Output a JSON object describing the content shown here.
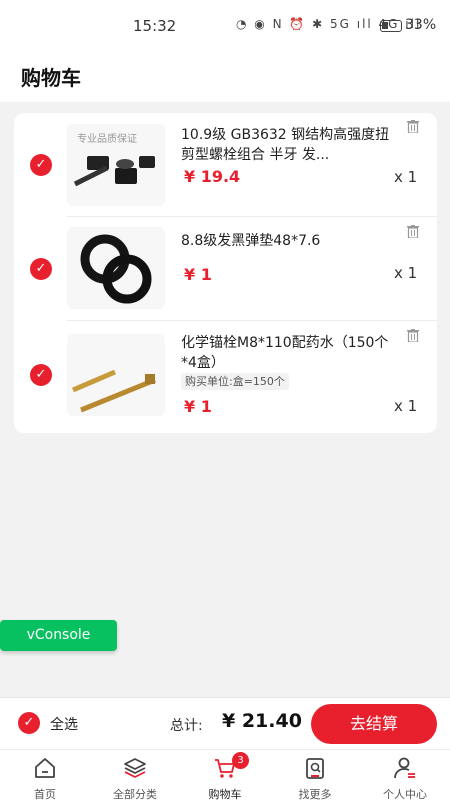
{
  "status_bar": {
    "time": "15:32",
    "battery": "33%",
    "indicators": "◔ ◉ N ⏰ ✱ 5G ıll 4G ıll"
  },
  "header": {
    "title": "购物车"
  },
  "cart_items": [
    {
      "name": "10.9级 GB3632 钢结构高强度扭剪型螺栓组合 半牙 发...",
      "price": "¥ 19.4",
      "qty": "x 1",
      "checked": true,
      "thumb_text": "专业品质保证"
    },
    {
      "name": "8.8级发黑弹垫48*7.6",
      "price": "¥ 1",
      "qty": "x 1",
      "checked": true
    },
    {
      "name": "化学锚栓M8*110配药水（150个*4盒）",
      "unit_tag": "购买单位:盒=150个",
      "price": "¥ 1",
      "qty": "x 1",
      "checked": true
    }
  ],
  "vconsole": {
    "label": "vConsole"
  },
  "footer": {
    "select_all": "全选",
    "total_label": "总计:",
    "total": "¥ 21.40",
    "checkout": "去结算"
  },
  "tabbar": {
    "tabs": [
      {
        "label": "首页",
        "icon": "home-icon"
      },
      {
        "label": "全部分类",
        "icon": "layers-icon"
      },
      {
        "label": "购物车",
        "icon": "cart-icon",
        "badge": "3",
        "active": true
      },
      {
        "label": "找更多",
        "icon": "search-more-icon"
      },
      {
        "label": "个人中心",
        "icon": "user-icon"
      }
    ]
  },
  "colors": {
    "accent": "#e8202e",
    "vconsole": "#07c160",
    "background": "#f2f2f2"
  }
}
